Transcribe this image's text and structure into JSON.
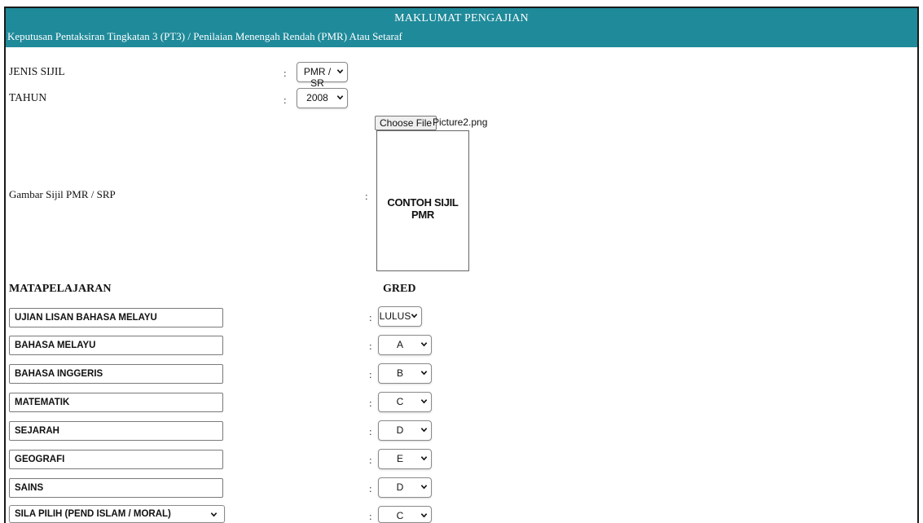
{
  "header": {
    "title": "MAKLUMAT PENGAJIAN",
    "subtitle": "Keputusan Pentaksiran Tingkatan 3 (PT3) / Penilaian Menengah Rendah (PMR) Atau Setaraf"
  },
  "form": {
    "colon": ":",
    "jenis_sijil": {
      "label": "JENIS SIJIL",
      "value": "PMR / SR"
    },
    "tahun": {
      "label": "TAHUN",
      "value": "2008"
    },
    "gambar": {
      "label": "Gambar Sijil PMR / SRP",
      "button": "Choose File",
      "file_name": "Picture2.png",
      "preview_text": "CONTOH SIJIL PMR"
    }
  },
  "subjects": {
    "header_subject": "MATAPELAJARAN",
    "header_grade": "GRED",
    "rows": [
      {
        "subject": "UJIAN LISAN BAHASA MELAYU",
        "grade": "LULUS"
      },
      {
        "subject": "BAHASA MELAYU",
        "grade": "A"
      },
      {
        "subject": "BAHASA INGGERIS",
        "grade": "B"
      },
      {
        "subject": "MATEMATIK",
        "grade": "C"
      },
      {
        "subject": "SEJARAH",
        "grade": "D"
      },
      {
        "subject": "GEOGRAFI",
        "grade": "E"
      },
      {
        "subject": "SAINS",
        "grade": "D"
      },
      {
        "subject": "SILA PILIH (PEND ISLAM / MORAL)",
        "grade": "C"
      }
    ]
  },
  "colors": {
    "header_bg": "#1f8a9a",
    "header_text": "#ffffff"
  },
  "icons": {
    "dropdown": "chevron-down-icon"
  }
}
